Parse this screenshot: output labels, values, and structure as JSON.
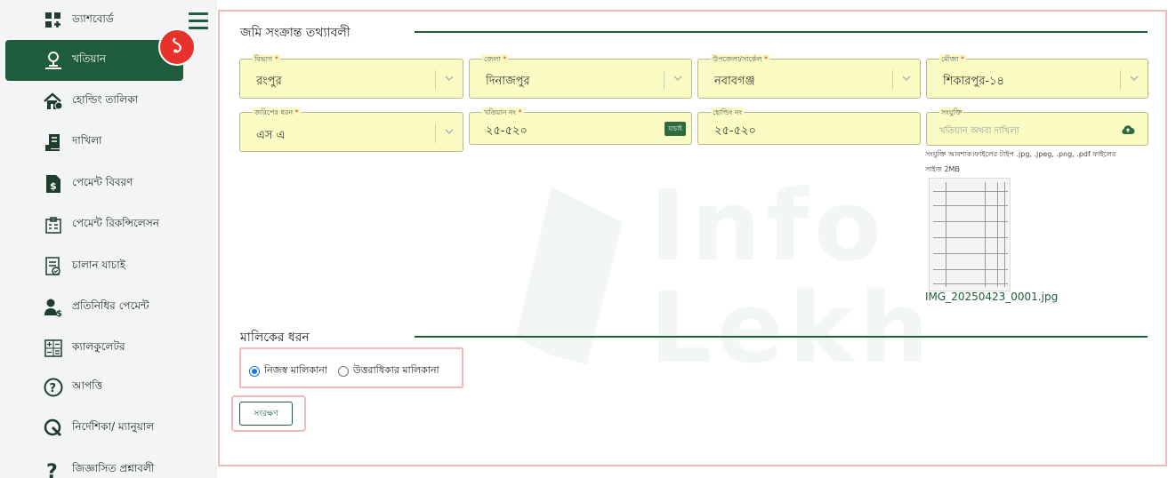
{
  "sidebar": {
    "items": [
      {
        "label": "ড্যাশবোর্ড",
        "icon": "dashboard-icon"
      },
      {
        "label": "খতিয়ান",
        "icon": "khatian-person-icon",
        "active": true
      },
      {
        "label": "হোল্ডিং তালিকা",
        "icon": "holding-house-icon"
      },
      {
        "label": "দাখিলা",
        "icon": "dakhila-icon"
      },
      {
        "label": "পেমেন্ট বিবরণ",
        "icon": "payment-doc-icon"
      },
      {
        "label": "পেমেন্ট রিকন্সিলেসন",
        "icon": "reconciliation-icon"
      },
      {
        "label": "চালান যাচাই",
        "icon": "challan-verify-icon"
      },
      {
        "label": "প্রতিনিধির পেমেন্ট",
        "icon": "representative-payment-icon"
      },
      {
        "label": "ক্যালকুলেটর",
        "icon": "calculator-icon"
      },
      {
        "label": "আপত্তি",
        "icon": "question-circle-icon"
      },
      {
        "label": "নির্দেশিকা/ ম্যানুয়াল",
        "icon": "guide-icon"
      },
      {
        "label": "জিজ্ঞাসিত প্রশ্নাবলী",
        "icon": "faq-icon"
      }
    ],
    "badge": "১",
    "menu_icon": "hamburger-icon"
  },
  "land_section": {
    "title": "জমি সংক্রান্ত তথ্যাবলী",
    "division": {
      "label": "বিভাগ",
      "value": "রংপুর"
    },
    "district": {
      "label": "জেলা",
      "value": "দিনাজপুর"
    },
    "upazila": {
      "label": "উপজেলা/সার্কেল",
      "value": "নবাবগঞ্জ"
    },
    "mouza": {
      "label": "মৌজা",
      "value": "শিকারপুর-১৪"
    },
    "survey_type": {
      "label": "জরিপের ধরন",
      "value": "এস এ"
    },
    "khatian_no": {
      "label": "খতিয়ান নং",
      "value": "২৫-৫২০",
      "verify_label": "যাচাই"
    },
    "holding_no": {
      "label": "হোল্ডিং নং",
      "value": "২৫-৫২০"
    },
    "attachment": {
      "label": "সংযুক্তি",
      "placeholder": "খতিয়ান অথবা দাখিলা"
    },
    "attachment_note_line1": "সংযুক্তি আবশ্যক।ফাইলের টাইপ .jpg, .jpeg, .png, .pdf ফাইলের",
    "attachment_note_line2": "সাইজ 2MB",
    "file_name": "IMG_20250423_0001.jpg",
    "required_mark": "*"
  },
  "owner_section": {
    "title": "মালিকের ধরন",
    "options": [
      "নিজস্ব মালিকানা",
      "উত্তরাধিকার মালিকানা"
    ],
    "selected": 0
  },
  "watermark": {
    "line1": "Info",
    "line2": "Lekh"
  },
  "save_label": "সংরক্ষণ",
  "colors": {
    "brand": "#1f5c3b",
    "field_bg": "#fbfbc4",
    "highlight": "#f2b8bc",
    "badge": "#e7322c"
  }
}
